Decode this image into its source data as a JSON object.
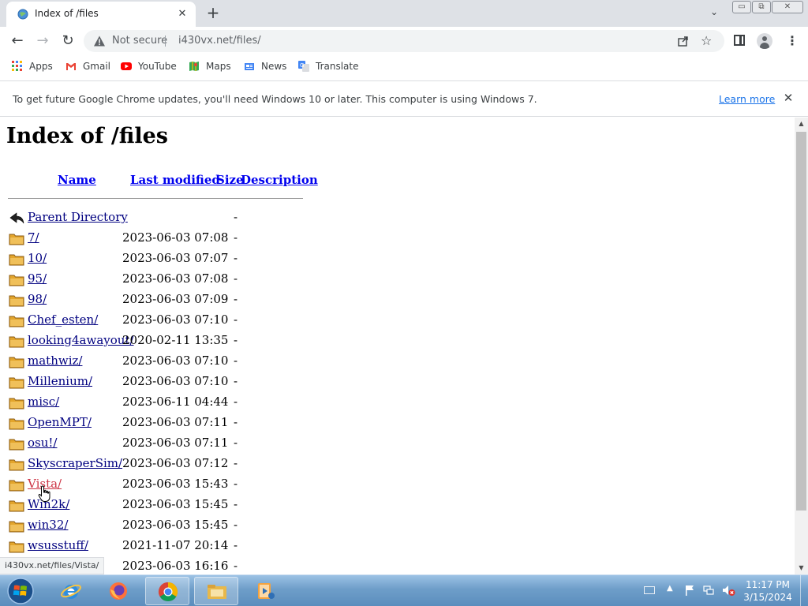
{
  "browser": {
    "tab_title": "Index of /files",
    "not_secure": "Not secure",
    "url": "i430vx.net/files/",
    "win_min": "▭",
    "win_max": "⧉",
    "win_close": "✕"
  },
  "bookmarks": [
    {
      "label": "Apps",
      "icon": "apps-grid-icon"
    },
    {
      "label": "Gmail",
      "icon": "gmail-icon"
    },
    {
      "label": "YouTube",
      "icon": "youtube-icon"
    },
    {
      "label": "Maps",
      "icon": "maps-icon"
    },
    {
      "label": "News",
      "icon": "news-icon"
    },
    {
      "label": "Translate",
      "icon": "translate-icon"
    }
  ],
  "infobar": {
    "message": "To get future Google Chrome updates, you'll need Windows 10 or later. This computer is using Windows 7.",
    "link": "Learn more"
  },
  "listing": {
    "heading": "Index of /files",
    "columns": {
      "name": "Name",
      "modified": "Last modified",
      "size": "Size",
      "description": "Description"
    },
    "rows": [
      {
        "name": "Parent Directory",
        "modified": "",
        "size": "-",
        "kind": "parent"
      },
      {
        "name": "7/",
        "modified": "2023-06-03 07:08",
        "size": "-",
        "kind": "folder"
      },
      {
        "name": "10/",
        "modified": "2023-06-03 07:07",
        "size": "-",
        "kind": "folder"
      },
      {
        "name": "95/",
        "modified": "2023-06-03 07:08",
        "size": "-",
        "kind": "folder"
      },
      {
        "name": "98/",
        "modified": "2023-06-03 07:09",
        "size": "-",
        "kind": "folder"
      },
      {
        "name": "Chef_esten/",
        "modified": "2023-06-03 07:10",
        "size": "-",
        "kind": "folder"
      },
      {
        "name": "looking4awayout/",
        "modified": "2020-02-11 13:35",
        "size": "-",
        "kind": "folder"
      },
      {
        "name": "mathwiz/",
        "modified": "2023-06-03 07:10",
        "size": "-",
        "kind": "folder"
      },
      {
        "name": "Millenium/",
        "modified": "2023-06-03 07:10",
        "size": "-",
        "kind": "folder"
      },
      {
        "name": "misc/",
        "modified": "2023-06-11 04:44",
        "size": "-",
        "kind": "folder"
      },
      {
        "name": "OpenMPT/",
        "modified": "2023-06-03 07:11",
        "size": "-",
        "kind": "folder"
      },
      {
        "name": "osu!/",
        "modified": "2023-06-03 07:11",
        "size": "-",
        "kind": "folder"
      },
      {
        "name": "SkyscraperSim/",
        "modified": "2023-06-03 07:12",
        "size": "-",
        "kind": "folder"
      },
      {
        "name": "Vista/",
        "modified": "2023-06-03 15:43",
        "size": "-",
        "kind": "folder",
        "hover": true
      },
      {
        "name": "Win2k/",
        "modified": "2023-06-03 15:45",
        "size": "-",
        "kind": "folder"
      },
      {
        "name": "win32/",
        "modified": "2023-06-03 15:45",
        "size": "-",
        "kind": "folder"
      },
      {
        "name": "wsusstuff/",
        "modified": "2021-11-07 20:14",
        "size": "-",
        "kind": "folder"
      },
      {
        "name": "",
        "modified": "2023-06-03 16:16",
        "size": "-",
        "kind": "folder"
      }
    ]
  },
  "status_bar": "i430vx.net/files/Vista/",
  "taskbar": {
    "apps": [
      "internet-explorer-icon",
      "firefox-icon",
      "chrome-icon",
      "file-explorer-icon",
      "media-player-icon"
    ],
    "time": "11:17 PM",
    "date": "3/15/2024"
  },
  "colors": {
    "link": "#000080",
    "link_hover": "#cc3344",
    "header_link": "#0000ee",
    "chrome_blue": "#1a73e8"
  }
}
